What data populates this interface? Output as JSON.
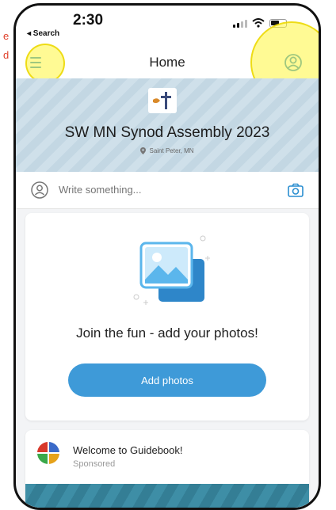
{
  "annotation": {
    "line1": "e",
    "line2": "d"
  },
  "status_bar": {
    "time": "2:30",
    "back_label": "◂ Search"
  },
  "nav": {
    "title": "Home",
    "menu_icon": "hamburger-menu-icon",
    "profile_icon": "user-circle-icon",
    "accent_color": "#2a8ed0",
    "highlight_color": "#fff53c"
  },
  "event": {
    "title": "SW MN Synod Assembly 2023",
    "location": "Saint Peter, MN"
  },
  "compose": {
    "placeholder": "Write something...",
    "camera_icon": "camera-icon"
  },
  "photos_card": {
    "message": "Join the fun - add your photos!",
    "button_label": "Add photos",
    "button_color": "#3e9ad8"
  },
  "sponsor": {
    "name": "Welcome to Guidebook!",
    "tag": "Sponsored"
  }
}
